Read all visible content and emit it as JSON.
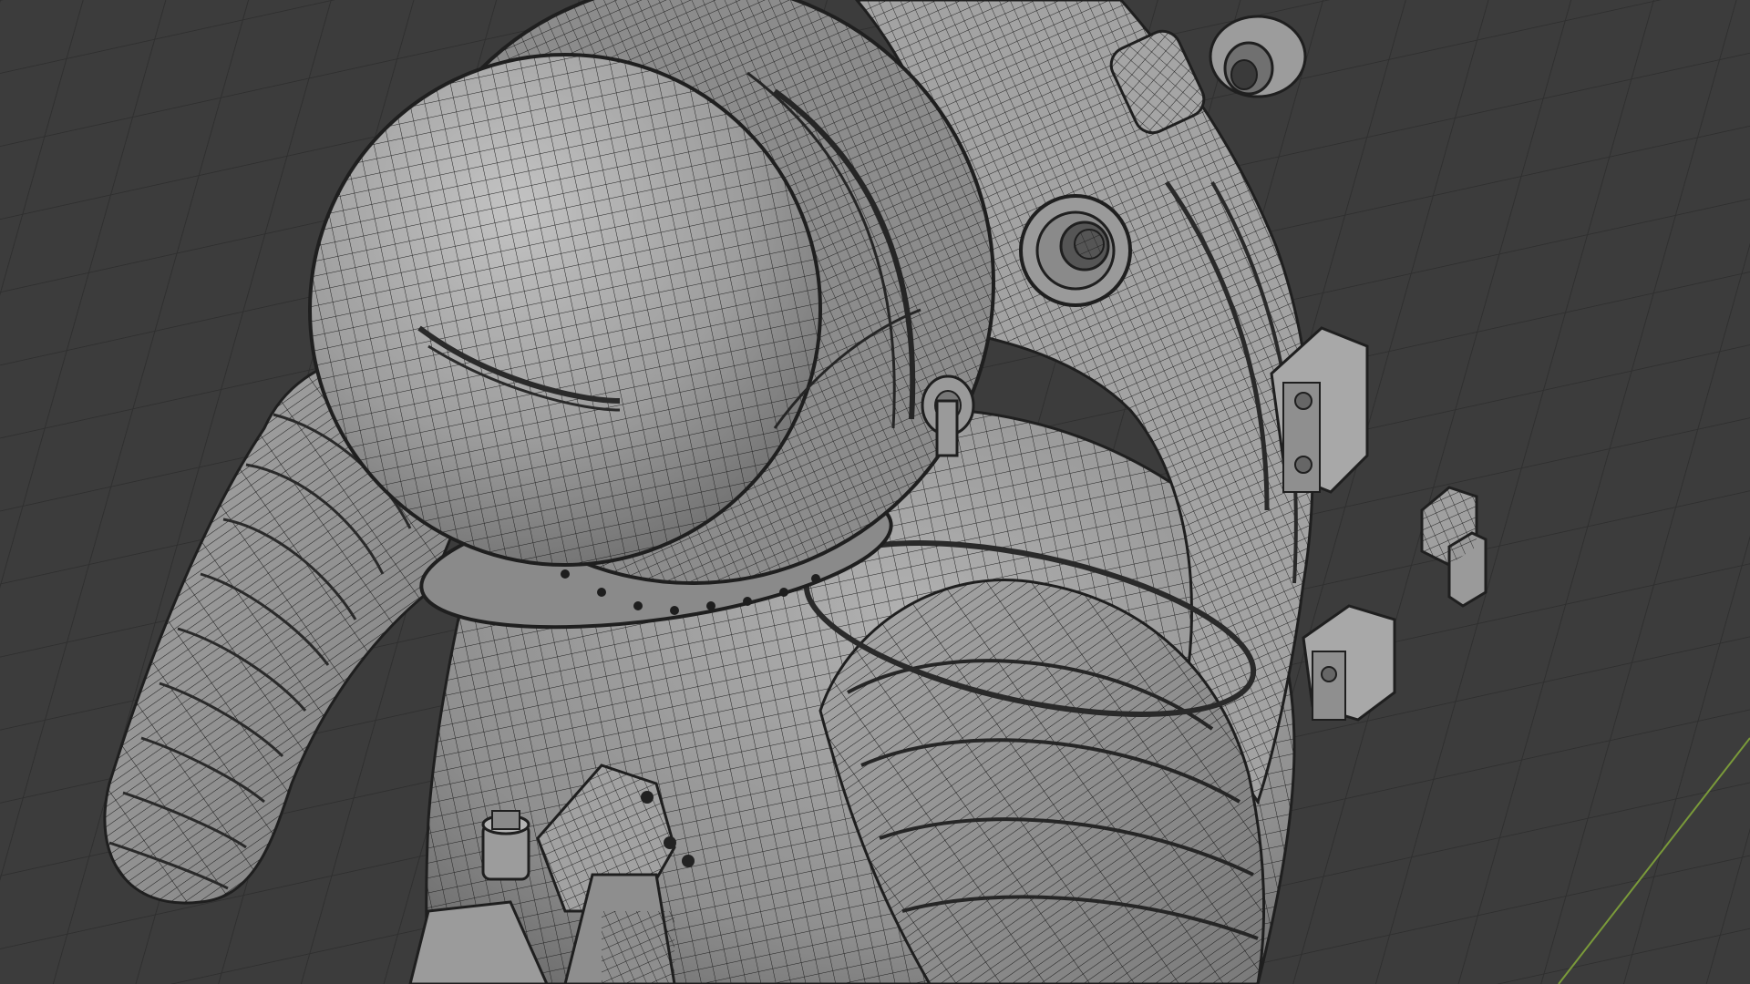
{
  "viewport": {
    "mode": "3d-viewport",
    "shading": "solid-wireframe-overlay",
    "object": "spacesuit-mesh"
  },
  "colors": {
    "background": "#3c3c3c",
    "floor_grid": "#2f2f2f",
    "mesh_fill": "#9a9a9a",
    "mesh_fill_light": "#b4b4b4",
    "mesh_fill_dark": "#6e6e6e",
    "wire": "#1e1e1e",
    "y_axis": "#7a9a3a"
  },
  "icons": {
    "axis_line": "y-axis-line",
    "grid": "floor-grid"
  }
}
